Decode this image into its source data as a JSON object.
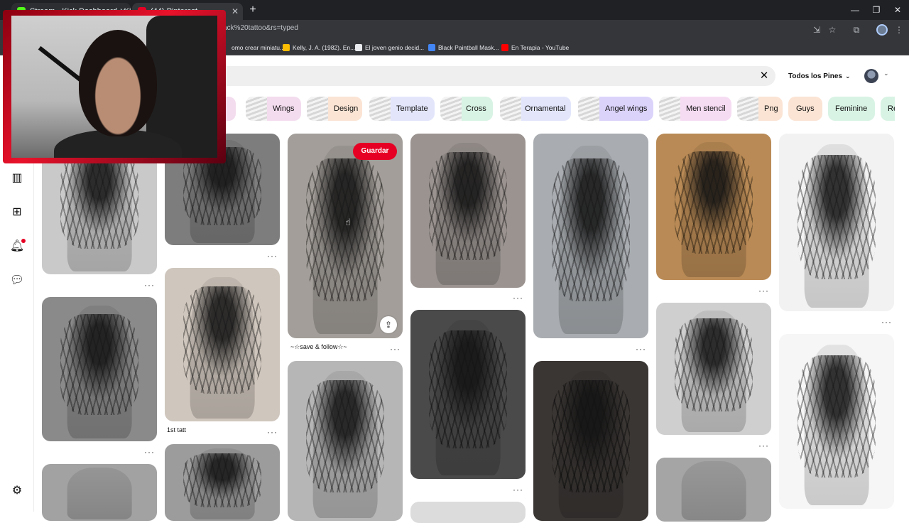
{
  "browser": {
    "tabs": [
      {
        "title": "Stream · Kick Dashboard · Kick",
        "favicon_color": "#53fc18"
      },
      {
        "title": "(44) Pinterest",
        "favicon_color": "#e60023"
      }
    ],
    "url": "ack%20tattoo&rs=typed",
    "bookmarks": [
      {
        "label": "omo crear miniatu...",
        "color": "#8ab4f8"
      },
      {
        "label": "Kelly, J. A. (1982). En...",
        "color": "#fbbc04"
      },
      {
        "label": "El joven genio decid...",
        "color": "#e8eaed"
      },
      {
        "label": "Black Paintball Mask...",
        "color": "#4285f4"
      },
      {
        "label": "En Terapia - YouTube",
        "color": "#ff0000"
      }
    ]
  },
  "pinterest": {
    "search": {
      "filter_label": "Todos los Pines"
    },
    "chips": [
      {
        "label": "hic",
        "bg": "#f3dcee",
        "thumb": false
      },
      {
        "label": "Wings",
        "bg": "#f3dcee",
        "thumb": true
      },
      {
        "label": "Design",
        "bg": "#fbe4d4",
        "thumb": true
      },
      {
        "label": "Template",
        "bg": "#e3e6fb",
        "thumb": true
      },
      {
        "label": "Cross",
        "bg": "#d8f3e4",
        "thumb": true
      },
      {
        "label": "Ornamental",
        "bg": "#e3e6fb",
        "thumb": true
      },
      {
        "label": "Angel wings",
        "bg": "#dcd3fb",
        "thumb": true
      },
      {
        "label": "Men stencil",
        "bg": "#f6dcf3",
        "thumb": true
      },
      {
        "label": "Png",
        "bg": "#fbe4d4",
        "thumb": true
      },
      {
        "label": "Guys",
        "bg": "#fbe4d4",
        "thumb": false
      },
      {
        "label": "Feminine",
        "bg": "#d8f3e4",
        "thumb": false
      },
      {
        "label": "Re",
        "bg": "#d8f3e4",
        "thumb": false
      }
    ],
    "pins": {
      "col2_pin2_title": "1st tatt",
      "col3_pin1_title": "~☆save & follow☆~",
      "save_label": "Guardar"
    },
    "icons": {
      "sidebar": [
        "boards-icon",
        "create-icon",
        "notifications-icon",
        "messages-icon",
        "settings-icon"
      ]
    }
  }
}
